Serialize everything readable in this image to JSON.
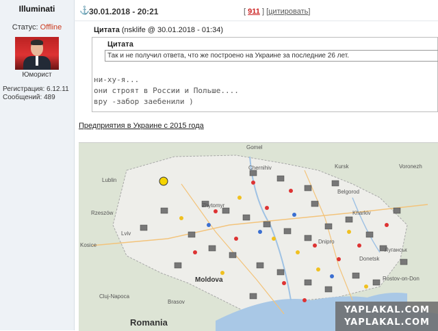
{
  "user": {
    "username": "Illuminati",
    "status_label": "Статус:",
    "status_value": "Offline",
    "rank": "Юморист",
    "registration": "Регистрация: 6.12.11",
    "messages": "Сообщений: 489"
  },
  "post": {
    "date": "30.01.2018 - 20:21",
    "number": "911",
    "bracket_open": "[",
    "bracket_close": "]",
    "quote_action": "цитировать"
  },
  "quote": {
    "label": "Цитата",
    "meta": "(nsklife @ 30.01.2018 - 01:34)",
    "inner_title": "Цитата",
    "inner_text": "Так и не получил ответа, что же построено на Украине за последние 26 лет.",
    "lines": [
      "ни-ху-я...",
      "они строят в России и Польше....",
      "вру -забор заебенили )"
    ]
  },
  "link_text": "Предприятия в Украине с 2015 года",
  "map": {
    "places": [
      "Gomel",
      "Chernihiv",
      "Kursk",
      "Voronezh",
      "Lublin",
      "Belgorod",
      "Rzeszów",
      "Kharkiv",
      "Kosice",
      "Lviv",
      "Zhytomyr",
      "Dnipro",
      "Donetsk",
      "Луганськ",
      "Rostov-on-Don",
      "Cluj-Napoca",
      "Brasov",
      "Moldova",
      "Romania"
    ],
    "watermarks": [
      "YAPLAKAL.COM",
      "YAPLAKAL.COM"
    ]
  },
  "icons": {
    "anchor": "anchor-icon"
  },
  "colors": {
    "offline": "#cc3b1f",
    "post_number": "#cc2222",
    "sidebar": "#eef2f6"
  }
}
